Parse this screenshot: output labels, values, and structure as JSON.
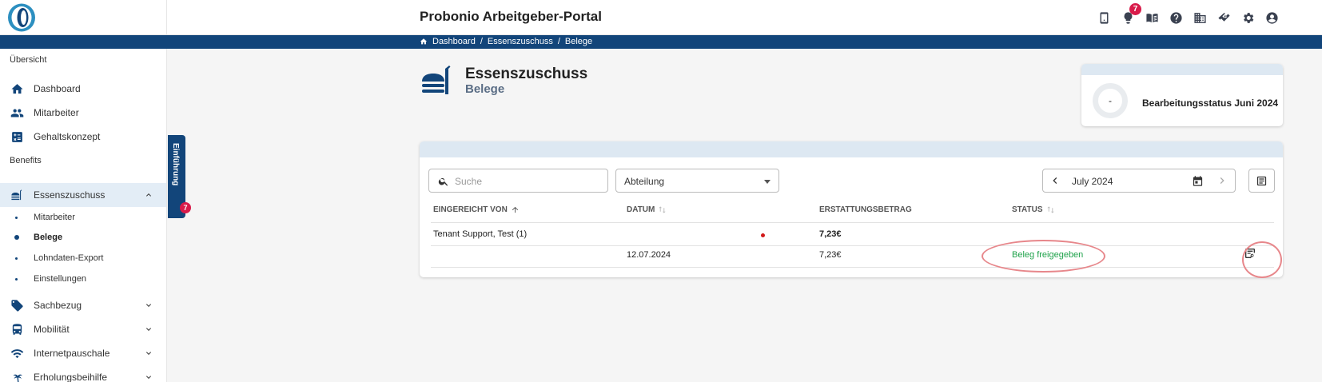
{
  "header": {
    "title": "Probonio Arbeitgeber-Portal",
    "notifications_count": "7",
    "icons": [
      "phone-icon",
      "lightbulb-icon",
      "book-icon",
      "help-icon",
      "building-icon",
      "handshake-icon",
      "gear-icon",
      "account-icon"
    ]
  },
  "breadcrumb": {
    "items": [
      "Dashboard",
      "/",
      "Essenszuschuss",
      "/",
      "Belege"
    ]
  },
  "sidebar": {
    "section_overview": "Übersicht",
    "overview_items": [
      "Dashboard",
      "Mitarbeiter",
      "Gehaltskonzept"
    ],
    "section_benefits": "Benefits",
    "benefit_active": "Essenszuschuss",
    "sub_items": [
      "Mitarbeiter",
      "Belege",
      "Lohndaten-Export",
      "Einstellungen"
    ],
    "benefit_items": [
      "Sachbezug",
      "Mobilität",
      "Internetpauschale",
      "Erholungsbeihilfe"
    ]
  },
  "intro_tab": {
    "label": "Einführung",
    "badge": "7"
  },
  "page": {
    "title": "Essenszuschuss",
    "subtitle": "Belege"
  },
  "status_card": {
    "value": "-",
    "title": "Bearbeitungsstatus Juni 2024"
  },
  "filters": {
    "search_placeholder": "Suche",
    "department": "Abteilung",
    "month": "July 2024"
  },
  "table": {
    "columns": [
      "EINGEREICHT VON",
      "DATUM",
      "ERSTATTUNGSBETRAG",
      "STATUS"
    ],
    "group_row": {
      "name": "Tenant Support, Test (1)",
      "amount": "7,23€"
    },
    "rows": [
      {
        "date": "12.07.2024",
        "amount": "7,23€",
        "status": "Beleg freigegeben"
      }
    ]
  },
  "colors": {
    "brand": "#12457a",
    "accent_light": "#dde8f2",
    "status_green": "#1ea24a",
    "badge_red": "#d81b4a"
  }
}
